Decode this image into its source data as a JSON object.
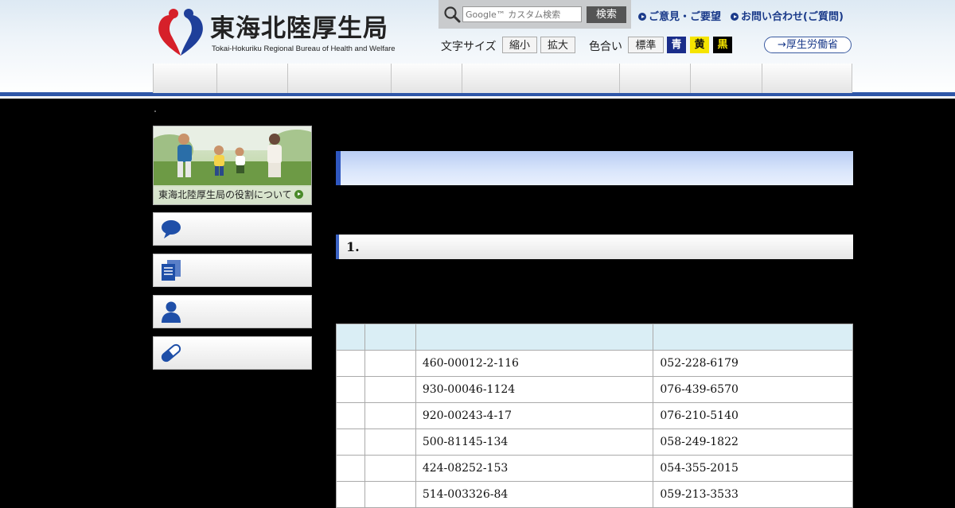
{
  "header": {
    "site_title": "東海北陸厚生局",
    "site_subtitle": "Tokai-Hokuriku Regional Bureau of Health and Welfare",
    "search": {
      "placeholder": "Google™ カスタム検索",
      "button_label": "検索"
    },
    "links": {
      "opinion": "ご意見・ご要望",
      "inquiry": "お問い合わせ(ご質問)"
    },
    "font_size": {
      "label": "文字サイズ",
      "smaller": "縮小",
      "larger": "拡大"
    },
    "color_scheme": {
      "label": "色合い",
      "standard": "標準",
      "blue": "青",
      "yellow": "黄",
      "black": "黒"
    },
    "mhlw_link": "→厚生労働省",
    "colors": {
      "accent": "#2f57a8",
      "link": "#1a3a8a"
    }
  },
  "sidebar": {
    "banner_caption": "東海北陸厚生局の役割について",
    "buttons": [
      {
        "icon": "speech-bubble-icon"
      },
      {
        "icon": "documents-icon"
      },
      {
        "icon": "person-icon"
      },
      {
        "icon": "capsule-icon"
      }
    ]
  },
  "main": {
    "section_heading": "1.",
    "table": {
      "rows": [
        {
          "code": "460-00012-2-116",
          "tel": "052-228-6179"
        },
        {
          "code": "930-00046-1124",
          "tel": "076-439-6570"
        },
        {
          "code": "920-00243-4-17",
          "tel": "076-210-5140"
        },
        {
          "code": "500-81145-134",
          "tel": "058-249-1822"
        },
        {
          "code": "424-08252-153",
          "tel": "054-355-2015"
        },
        {
          "code": "514-003326-84",
          "tel": "059-213-3533"
        }
      ]
    }
  }
}
